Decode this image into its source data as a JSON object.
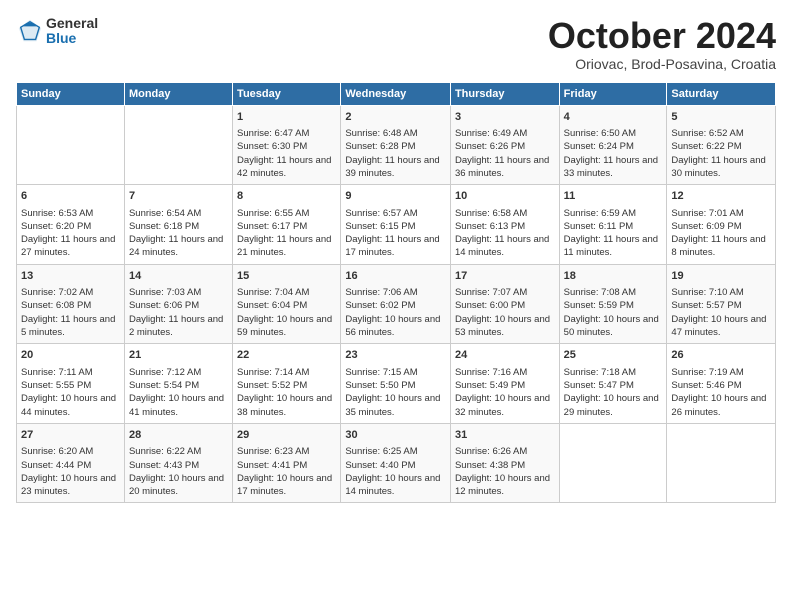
{
  "header": {
    "logo_general": "General",
    "logo_blue": "Blue",
    "month": "October 2024",
    "location": "Oriovac, Brod-Posavina, Croatia"
  },
  "weekdays": [
    "Sunday",
    "Monday",
    "Tuesday",
    "Wednesday",
    "Thursday",
    "Friday",
    "Saturday"
  ],
  "weeks": [
    [
      {
        "day": "",
        "text": ""
      },
      {
        "day": "",
        "text": ""
      },
      {
        "day": "1",
        "text": "Sunrise: 6:47 AM\nSunset: 6:30 PM\nDaylight: 11 hours and 42 minutes."
      },
      {
        "day": "2",
        "text": "Sunrise: 6:48 AM\nSunset: 6:28 PM\nDaylight: 11 hours and 39 minutes."
      },
      {
        "day": "3",
        "text": "Sunrise: 6:49 AM\nSunset: 6:26 PM\nDaylight: 11 hours and 36 minutes."
      },
      {
        "day": "4",
        "text": "Sunrise: 6:50 AM\nSunset: 6:24 PM\nDaylight: 11 hours and 33 minutes."
      },
      {
        "day": "5",
        "text": "Sunrise: 6:52 AM\nSunset: 6:22 PM\nDaylight: 11 hours and 30 minutes."
      }
    ],
    [
      {
        "day": "6",
        "text": "Sunrise: 6:53 AM\nSunset: 6:20 PM\nDaylight: 11 hours and 27 minutes."
      },
      {
        "day": "7",
        "text": "Sunrise: 6:54 AM\nSunset: 6:18 PM\nDaylight: 11 hours and 24 minutes."
      },
      {
        "day": "8",
        "text": "Sunrise: 6:55 AM\nSunset: 6:17 PM\nDaylight: 11 hours and 21 minutes."
      },
      {
        "day": "9",
        "text": "Sunrise: 6:57 AM\nSunset: 6:15 PM\nDaylight: 11 hours and 17 minutes."
      },
      {
        "day": "10",
        "text": "Sunrise: 6:58 AM\nSunset: 6:13 PM\nDaylight: 11 hours and 14 minutes."
      },
      {
        "day": "11",
        "text": "Sunrise: 6:59 AM\nSunset: 6:11 PM\nDaylight: 11 hours and 11 minutes."
      },
      {
        "day": "12",
        "text": "Sunrise: 7:01 AM\nSunset: 6:09 PM\nDaylight: 11 hours and 8 minutes."
      }
    ],
    [
      {
        "day": "13",
        "text": "Sunrise: 7:02 AM\nSunset: 6:08 PM\nDaylight: 11 hours and 5 minutes."
      },
      {
        "day": "14",
        "text": "Sunrise: 7:03 AM\nSunset: 6:06 PM\nDaylight: 11 hours and 2 minutes."
      },
      {
        "day": "15",
        "text": "Sunrise: 7:04 AM\nSunset: 6:04 PM\nDaylight: 10 hours and 59 minutes."
      },
      {
        "day": "16",
        "text": "Sunrise: 7:06 AM\nSunset: 6:02 PM\nDaylight: 10 hours and 56 minutes."
      },
      {
        "day": "17",
        "text": "Sunrise: 7:07 AM\nSunset: 6:00 PM\nDaylight: 10 hours and 53 minutes."
      },
      {
        "day": "18",
        "text": "Sunrise: 7:08 AM\nSunset: 5:59 PM\nDaylight: 10 hours and 50 minutes."
      },
      {
        "day": "19",
        "text": "Sunrise: 7:10 AM\nSunset: 5:57 PM\nDaylight: 10 hours and 47 minutes."
      }
    ],
    [
      {
        "day": "20",
        "text": "Sunrise: 7:11 AM\nSunset: 5:55 PM\nDaylight: 10 hours and 44 minutes."
      },
      {
        "day": "21",
        "text": "Sunrise: 7:12 AM\nSunset: 5:54 PM\nDaylight: 10 hours and 41 minutes."
      },
      {
        "day": "22",
        "text": "Sunrise: 7:14 AM\nSunset: 5:52 PM\nDaylight: 10 hours and 38 minutes."
      },
      {
        "day": "23",
        "text": "Sunrise: 7:15 AM\nSunset: 5:50 PM\nDaylight: 10 hours and 35 minutes."
      },
      {
        "day": "24",
        "text": "Sunrise: 7:16 AM\nSunset: 5:49 PM\nDaylight: 10 hours and 32 minutes."
      },
      {
        "day": "25",
        "text": "Sunrise: 7:18 AM\nSunset: 5:47 PM\nDaylight: 10 hours and 29 minutes."
      },
      {
        "day": "26",
        "text": "Sunrise: 7:19 AM\nSunset: 5:46 PM\nDaylight: 10 hours and 26 minutes."
      }
    ],
    [
      {
        "day": "27",
        "text": "Sunrise: 6:20 AM\nSunset: 4:44 PM\nDaylight: 10 hours and 23 minutes."
      },
      {
        "day": "28",
        "text": "Sunrise: 6:22 AM\nSunset: 4:43 PM\nDaylight: 10 hours and 20 minutes."
      },
      {
        "day": "29",
        "text": "Sunrise: 6:23 AM\nSunset: 4:41 PM\nDaylight: 10 hours and 17 minutes."
      },
      {
        "day": "30",
        "text": "Sunrise: 6:25 AM\nSunset: 4:40 PM\nDaylight: 10 hours and 14 minutes."
      },
      {
        "day": "31",
        "text": "Sunrise: 6:26 AM\nSunset: 4:38 PM\nDaylight: 10 hours and 12 minutes."
      },
      {
        "day": "",
        "text": ""
      },
      {
        "day": "",
        "text": ""
      }
    ]
  ]
}
